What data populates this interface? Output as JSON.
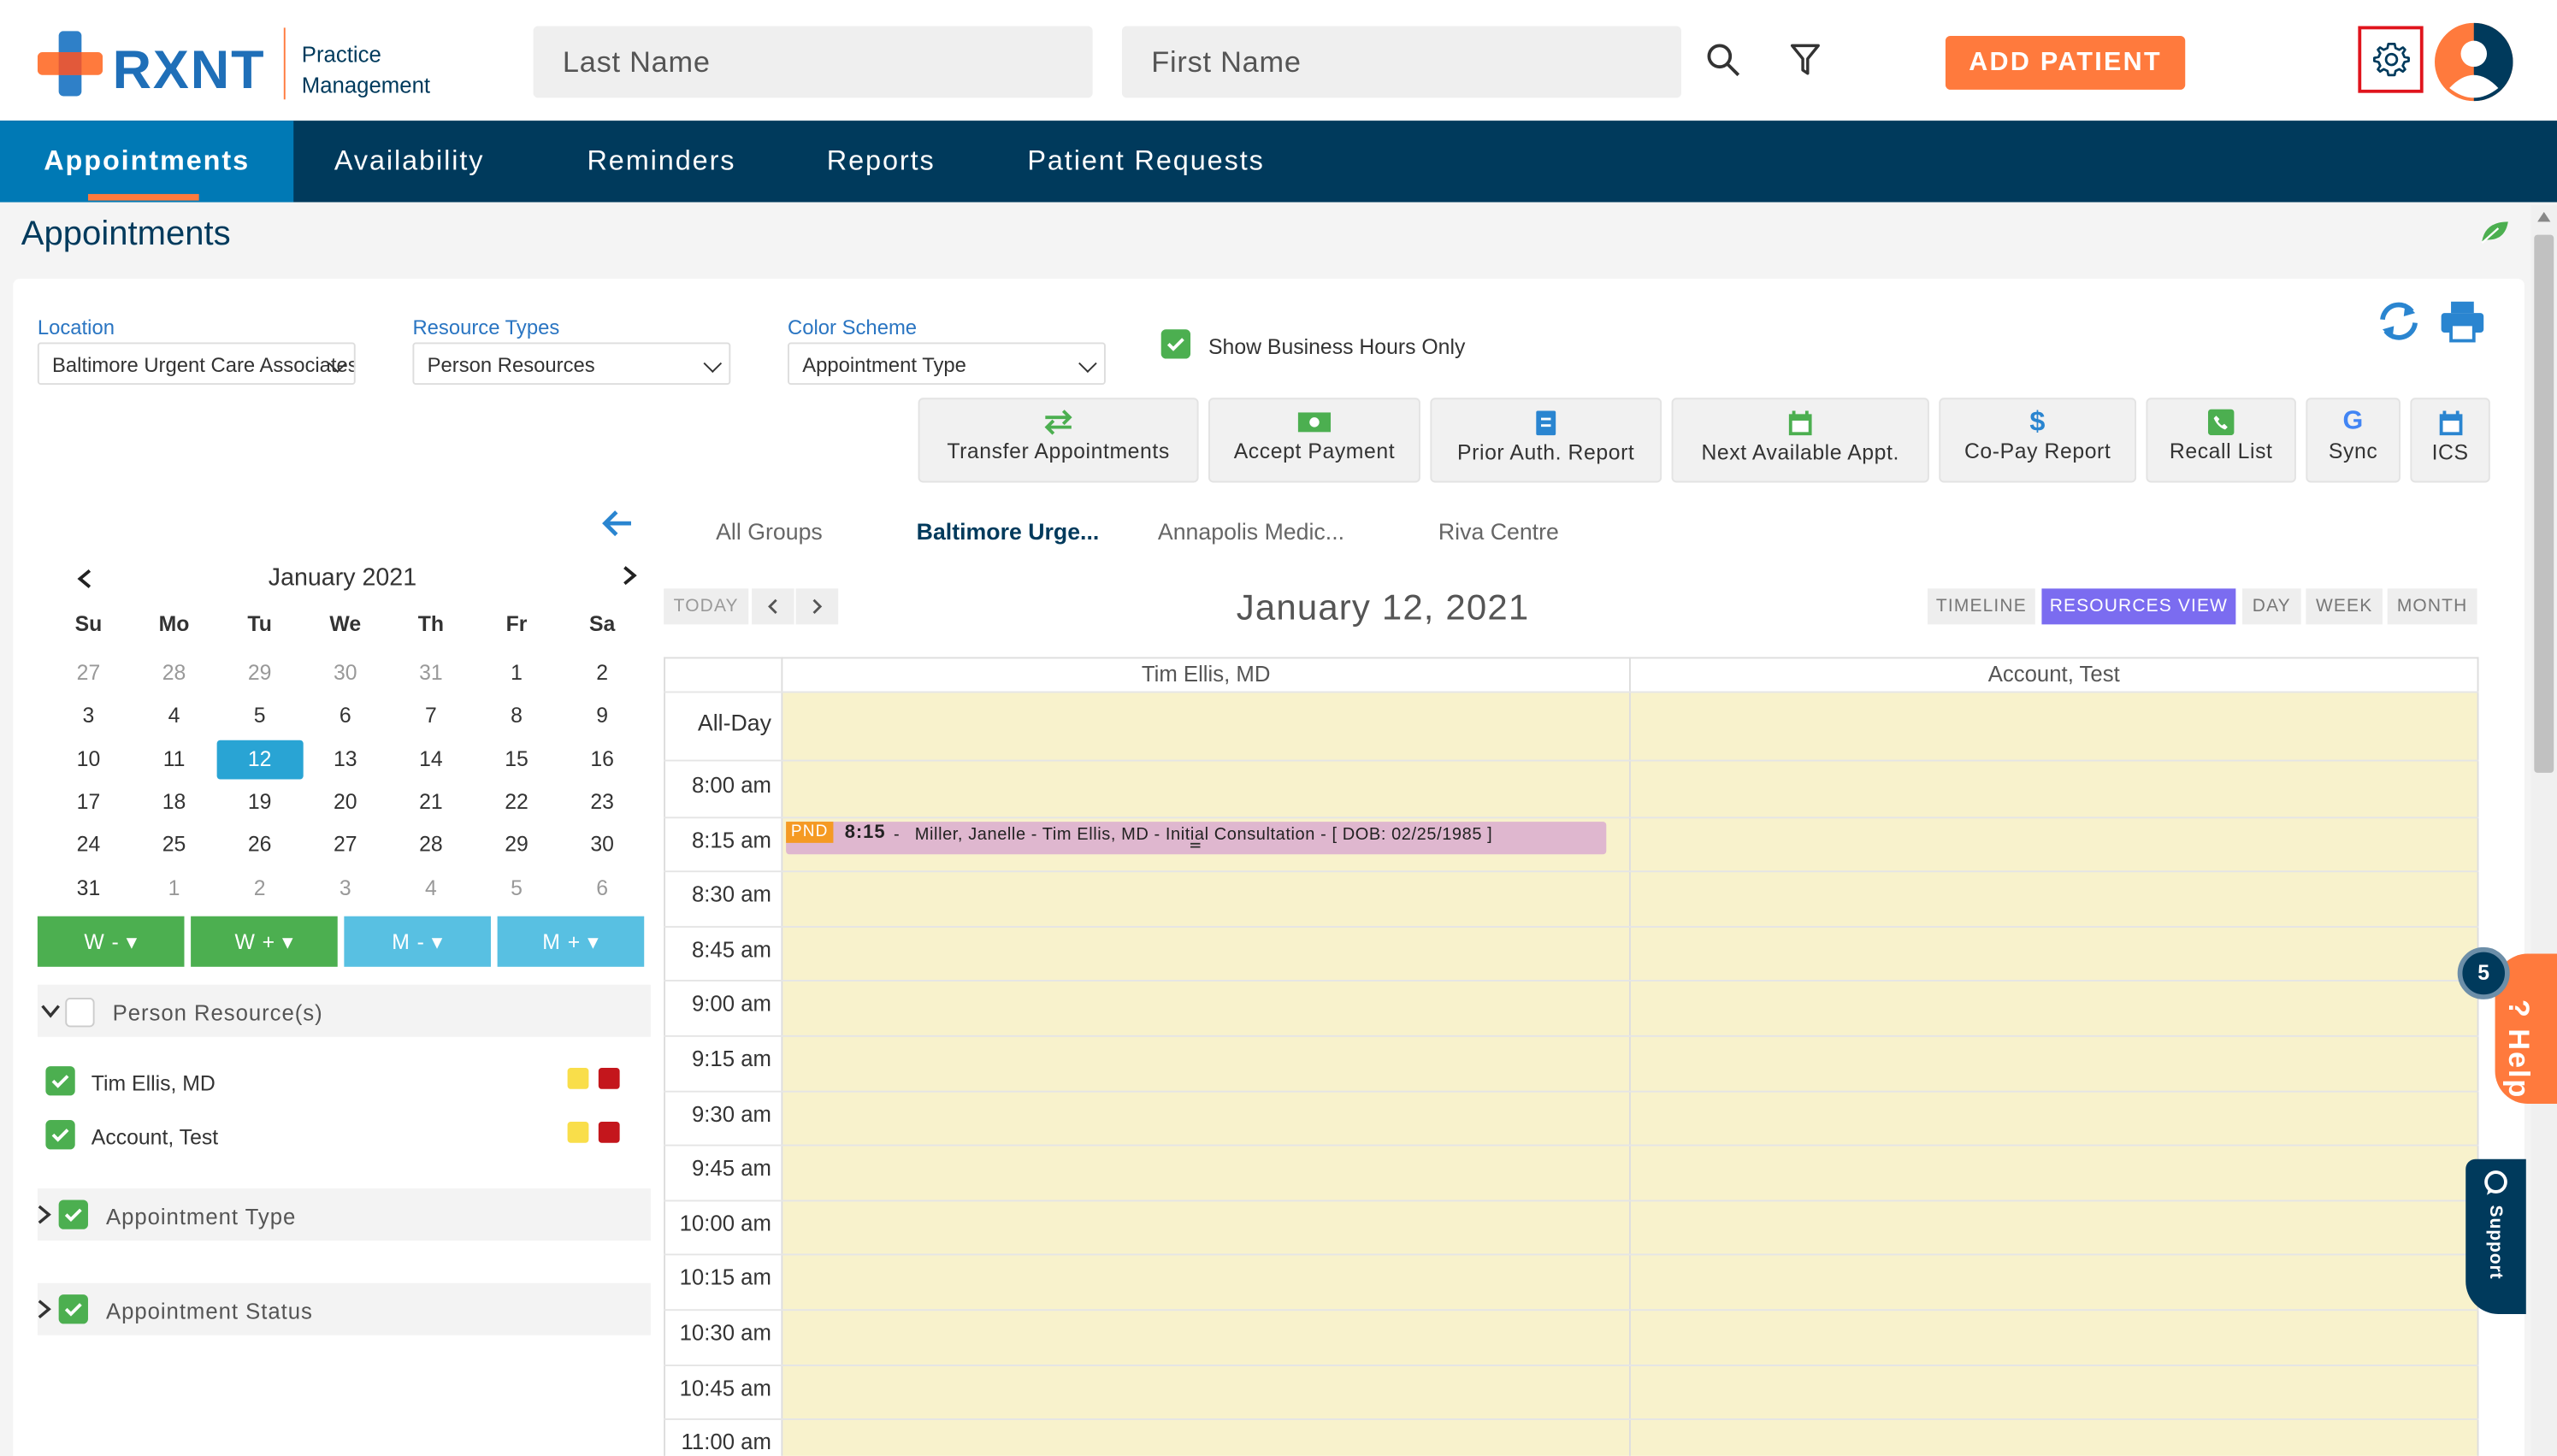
{
  "brand": {
    "name": "RXNT",
    "sub1": "Practice",
    "sub2": "Management"
  },
  "search": {
    "last_name_placeholder": "Last Name",
    "first_name_placeholder": "First Name"
  },
  "header": {
    "add_patient": "ADD PATIENT"
  },
  "nav": {
    "items": [
      "Appointments",
      "Availability",
      "Reminders",
      "Reports",
      "Patient Requests"
    ]
  },
  "page": {
    "title": "Appointments"
  },
  "filters": {
    "location_label": "Location",
    "location_value": "Baltimore Urgent Care Associates",
    "resource_label": "Resource Types",
    "resource_value": "Person Resources",
    "color_label": "Color Scheme",
    "color_value": "Appointment Type",
    "business_hours": "Show Business Hours Only"
  },
  "toolbar": [
    "Transfer Appointments",
    "Accept Payment",
    "Prior Auth. Report",
    "Next Available Appt.",
    "Co-Pay Report",
    "Recall List",
    "Sync",
    "ICS"
  ],
  "mini_calendar": {
    "month": "January 2021",
    "weekdays": [
      "Su",
      "Mo",
      "Tu",
      "We",
      "Th",
      "Fr",
      "Sa"
    ],
    "weeks": [
      [
        "27",
        "28",
        "29",
        "30",
        "31",
        "1",
        "2"
      ],
      [
        "3",
        "4",
        "5",
        "6",
        "7",
        "8",
        "9"
      ],
      [
        "10",
        "11",
        "12",
        "13",
        "14",
        "15",
        "16"
      ],
      [
        "17",
        "18",
        "19",
        "20",
        "21",
        "22",
        "23"
      ],
      [
        "24",
        "25",
        "26",
        "27",
        "28",
        "29",
        "30"
      ],
      [
        "31",
        "1",
        "2",
        "3",
        "4",
        "5",
        "6"
      ]
    ],
    "selected": "12",
    "nav_buttons": [
      "W -",
      "W +",
      "M -",
      "M +"
    ]
  },
  "side_panel": {
    "person_header": "Person Resource(s)",
    "resources": [
      "Tim Ellis, MD",
      "Account, Test"
    ],
    "appointment_type": "Appointment Type",
    "appointment_status": "Appointment Status"
  },
  "groups": {
    "tabs": [
      "All Groups",
      "Baltimore Urge...",
      "Annapolis Medic...",
      "Riva Centre"
    ],
    "active": "Baltimore Urge..."
  },
  "schedule": {
    "today": "TODAY",
    "date": "January 12, 2021",
    "views": [
      "TIMELINE",
      "RESOURCES VIEW",
      "DAY",
      "WEEK",
      "MONTH"
    ],
    "active_view": "RESOURCES VIEW",
    "columns": [
      "Tim Ellis, MD",
      "Account, Test"
    ],
    "allday": "All-Day",
    "times": [
      "8:00 am",
      "8:15 am",
      "8:30 am",
      "8:45 am",
      "9:00 am",
      "9:15 am",
      "9:30 am",
      "9:45 am",
      "10:00 am",
      "10:15 am",
      "10:30 am",
      "10:45 am",
      "11:00 am"
    ],
    "appointment": {
      "status": "PND",
      "time": "8:15",
      "text": "Miller, Janelle - Tim Ellis, MD - Initial Consultation - [ DOB: 02/25/1985 ]"
    }
  },
  "help": {
    "badge": "5",
    "label": "Help",
    "support": "Support"
  },
  "colors": {
    "navy": "#003a5c",
    "accent_blue": "#0079b5",
    "orange": "#ff7a3d",
    "green": "#4caf50",
    "calendar_bg": "#f8f2cc",
    "appt_pink": "#dfb7cf"
  }
}
